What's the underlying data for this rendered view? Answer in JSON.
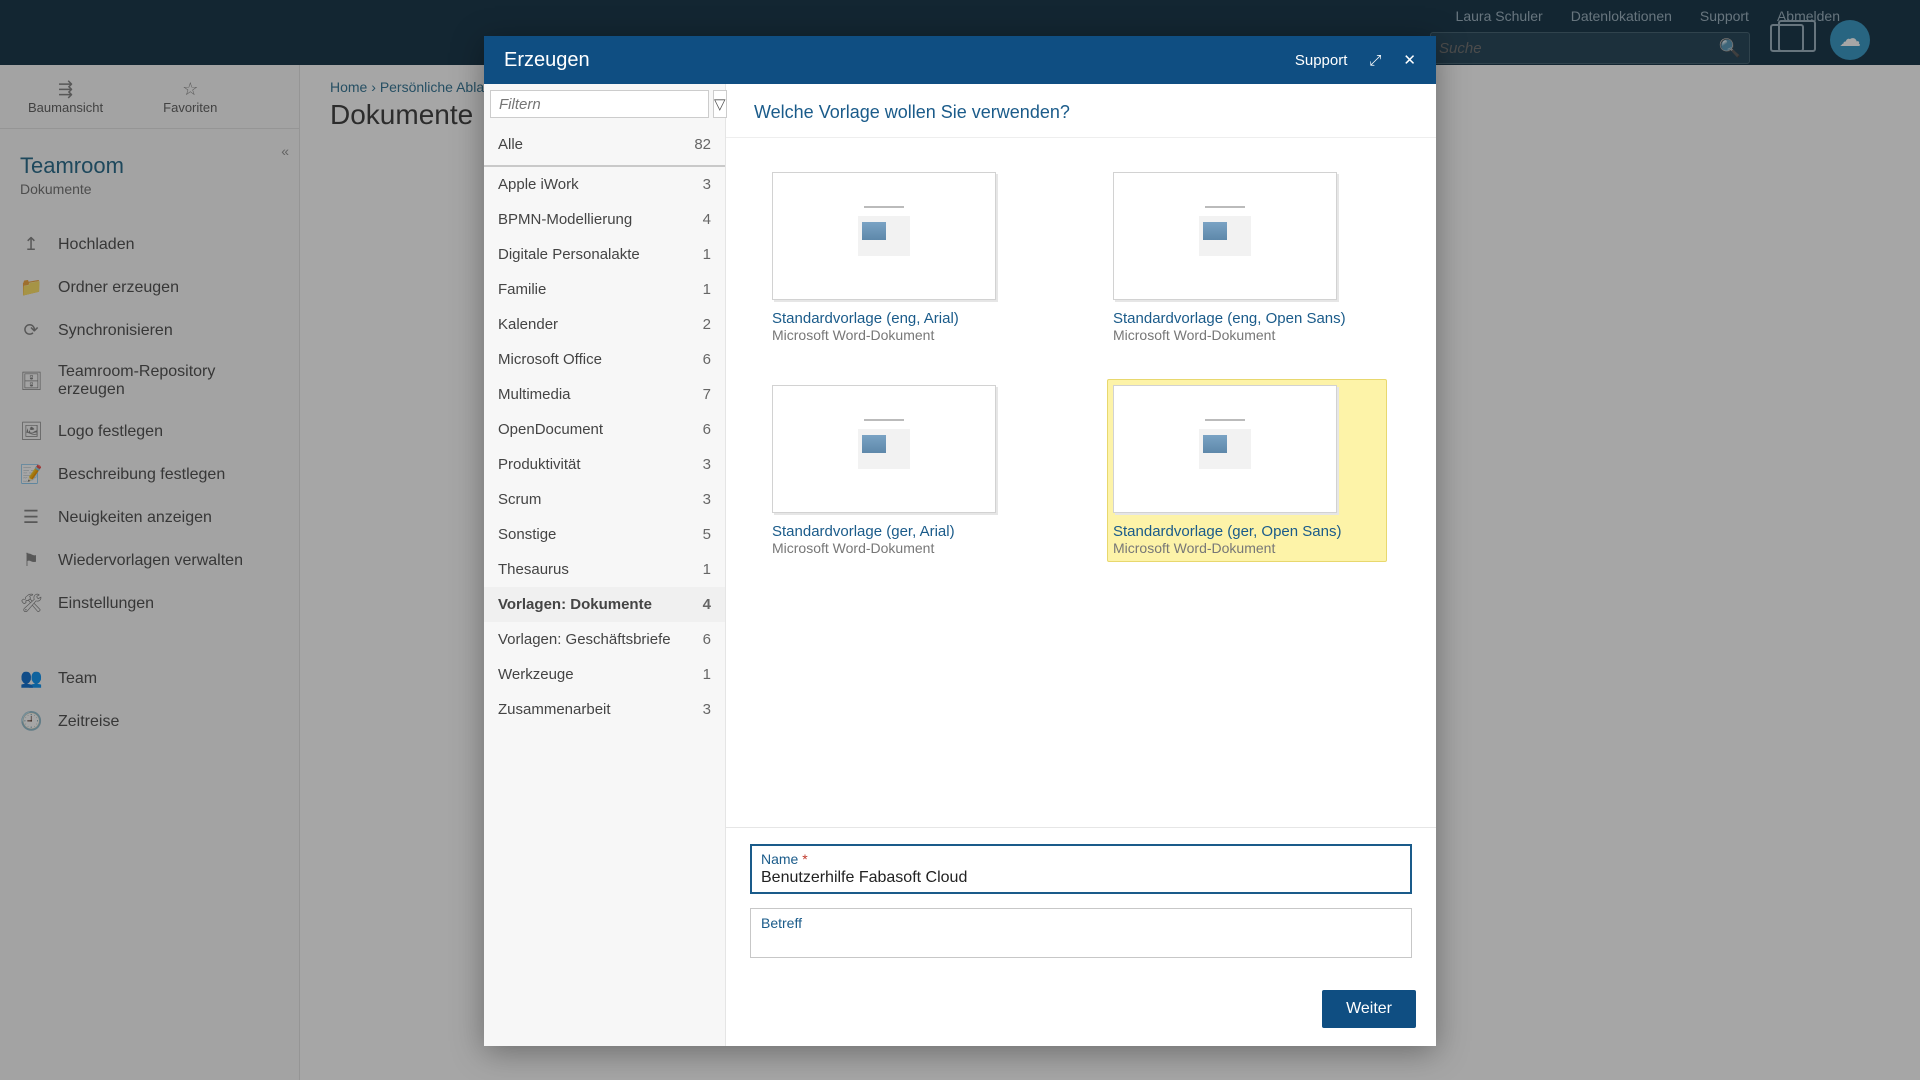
{
  "topbar": {
    "links": [
      "Laura Schuler",
      "Datenlokationen",
      "Support",
      "Abmelden"
    ],
    "search_placeholder": "Suche"
  },
  "view_toggles": {
    "tree": "Baumansicht",
    "favorites": "Favoriten"
  },
  "teamroom": {
    "title": "Teamroom",
    "subtitle": "Dokumente"
  },
  "side_actions": [
    {
      "icon": "↥",
      "label": "Hochladen"
    },
    {
      "icon": "📁",
      "label": "Ordner erzeugen"
    },
    {
      "icon": "⟳",
      "label": "Synchronisieren"
    },
    {
      "icon": "🗄",
      "label": "Teamroom-Repository erzeugen"
    },
    {
      "icon": "🖼",
      "label": "Logo festlegen"
    },
    {
      "icon": "📝",
      "label": "Beschreibung festlegen"
    },
    {
      "icon": "☰",
      "label": "Neuigkeiten anzeigen"
    },
    {
      "icon": "⚑",
      "label": "Wiedervorlagen verwalten"
    },
    {
      "icon": "🛠",
      "label": "Einstellungen"
    }
  ],
  "side_actions_lower": [
    {
      "icon": "👥",
      "label": "Team"
    },
    {
      "icon": "🕘",
      "label": "Zeitreise"
    }
  ],
  "breadcrumb": {
    "parts": [
      "Home",
      "Persönliche Ablage"
    ],
    "sep": "›"
  },
  "page_title": "Dokumente",
  "modal": {
    "title": "Erzeugen",
    "support_label": "Support",
    "filter_placeholder": "Filtern",
    "all_label": "Alle",
    "all_count": "82",
    "categories": [
      {
        "label": "Apple iWork",
        "count": "3"
      },
      {
        "label": "BPMN-Modellierung",
        "count": "4"
      },
      {
        "label": "Digitale Personalakte",
        "count": "1"
      },
      {
        "label": "Familie",
        "count": "1"
      },
      {
        "label": "Kalender",
        "count": "2"
      },
      {
        "label": "Microsoft Office",
        "count": "6"
      },
      {
        "label": "Multimedia",
        "count": "7"
      },
      {
        "label": "OpenDocument",
        "count": "6"
      },
      {
        "label": "Produktivität",
        "count": "3"
      },
      {
        "label": "Scrum",
        "count": "3"
      },
      {
        "label": "Sonstige",
        "count": "5"
      },
      {
        "label": "Thesaurus",
        "count": "1"
      },
      {
        "label": "Vorlagen: Dokumente",
        "count": "4",
        "active": true
      },
      {
        "label": "Vorlagen: Geschäftsbriefe",
        "count": "6"
      },
      {
        "label": "Werkzeuge",
        "count": "1"
      },
      {
        "label": "Zusammenarbeit",
        "count": "3"
      }
    ],
    "question": "Welche Vorlage wollen Sie verwenden?",
    "templates": [
      {
        "name": "Standardvorlage (eng, Arial)",
        "type": "Microsoft Word-Dokument",
        "selected": false
      },
      {
        "name": "Standardvorlage (eng, Open Sans)",
        "type": "Microsoft Word-Dokument",
        "selected": false
      },
      {
        "name": "Standardvorlage (ger, Arial)",
        "type": "Microsoft Word-Dokument",
        "selected": false
      },
      {
        "name": "Standardvorlage (ger, Open Sans)",
        "type": "Microsoft Word-Dokument",
        "selected": true
      }
    ],
    "form": {
      "name_label": "Name",
      "name_value": "Benutzerhilfe Fabasoft Cloud",
      "betreff_label": "Betreff",
      "betreff_value": ""
    },
    "next_button": "Weiter"
  }
}
